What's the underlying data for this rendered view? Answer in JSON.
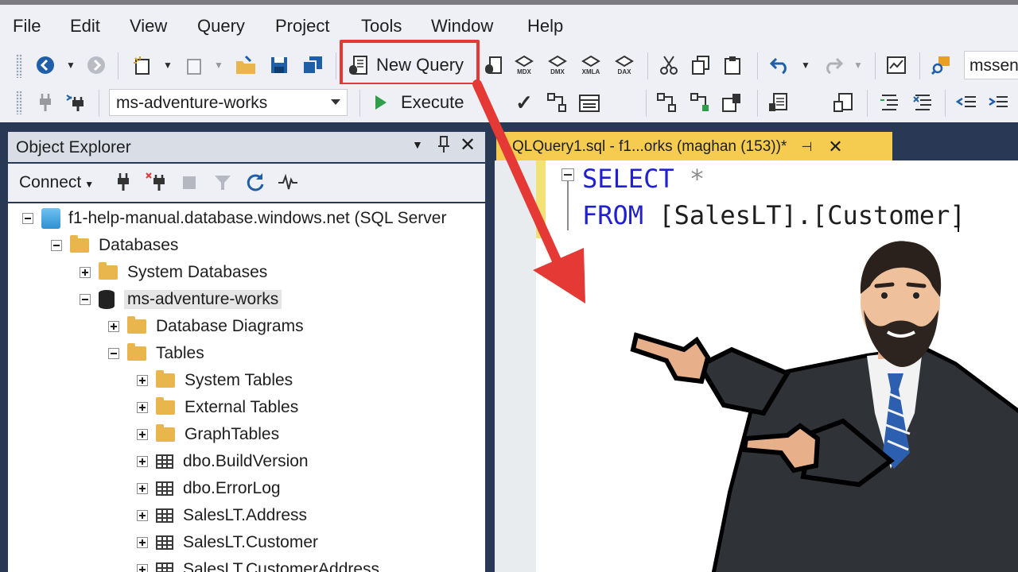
{
  "menu": {
    "items": [
      {
        "label": "File"
      },
      {
        "label": "Edit"
      },
      {
        "label": "View"
      },
      {
        "label": "Query"
      },
      {
        "label": "Project"
      },
      {
        "label": "Tools"
      },
      {
        "label": "Window"
      },
      {
        "label": "Help"
      }
    ]
  },
  "toolbar": {
    "new_query_label": "New Query",
    "server_box_text": "mssen",
    "mdx_label": "MDX",
    "dmx_label": "DMX",
    "xmla_label": "XMLA",
    "dax_label": "DAX",
    "database_selected": "ms-adventure-works",
    "execute_label": "Execute",
    "highlight_color": "#e53935"
  },
  "object_explorer": {
    "title": "Object Explorer",
    "connect_label": "Connect",
    "tree": {
      "server": "f1-help-manual.database.windows.net (SQL Server",
      "databases": "Databases",
      "system_databases": "System Databases",
      "database": "ms-adventure-works",
      "database_diagrams": "Database Diagrams",
      "tables": "Tables",
      "system_tables": "System Tables",
      "external_tables": "External Tables",
      "graph_tables": "GraphTables",
      "table_items": [
        "dbo.BuildVersion",
        "dbo.ErrorLog",
        "SalesLT.Address",
        "SalesLT.Customer",
        "SalesLT.CustomerAddress"
      ]
    }
  },
  "editor": {
    "tab_title": "QLQuery1.sql - f1...orks (maghan (153))*",
    "line1_keyword": "SELECT",
    "line1_rest": " *",
    "line2_keyword": "FROM",
    "line2_rest_a": " [SalesLT].[Custome",
    "line2_rest_b": "r]"
  },
  "colors": {
    "panel_dark": "#293955",
    "tab_active": "#f5cc4f",
    "keyword": "#2020d0",
    "arrow": "#e53935"
  }
}
